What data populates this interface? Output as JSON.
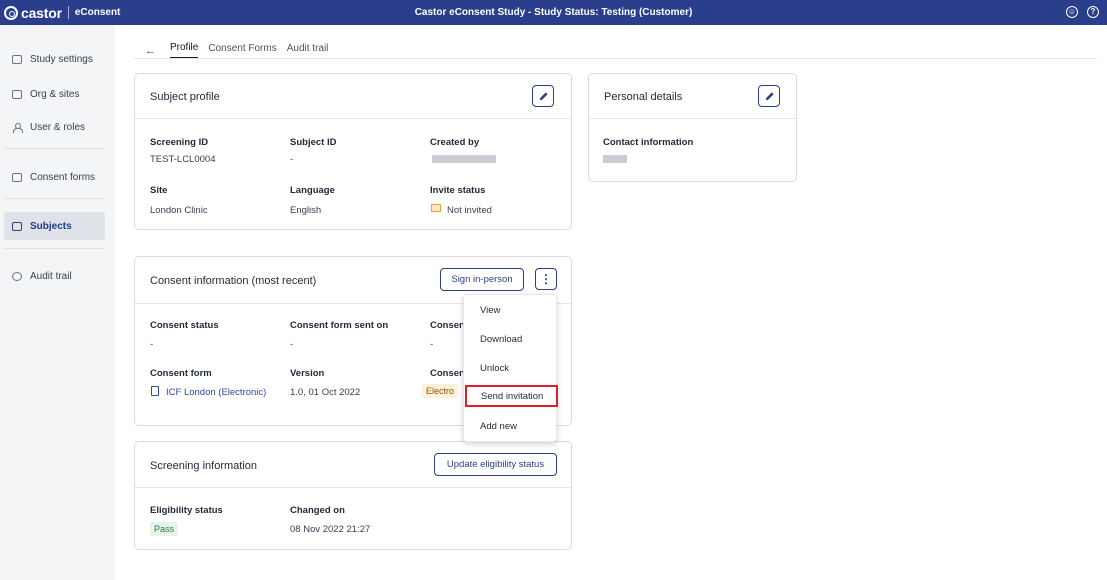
{
  "topbar": {
    "brand": "castor",
    "product": "eConsent",
    "study_title": "Castor eConsent Study  - Study Status: Testing (Customer)"
  },
  "sidebar": {
    "items": [
      {
        "label": "Study settings",
        "icon": "folder-icon"
      },
      {
        "label": "Org & sites",
        "icon": "building-icon"
      },
      {
        "label": "User & roles",
        "icon": "users-icon"
      },
      {
        "label": "Consent forms",
        "icon": "document-icon"
      },
      {
        "label": "Subjects",
        "icon": "subjects-icon",
        "active": true
      },
      {
        "label": "Audit trail",
        "icon": "history-icon"
      }
    ]
  },
  "tabs": [
    "Profile",
    "Consent Forms",
    "Audit trail"
  ],
  "subject_profile": {
    "title": "Subject profile",
    "fields": [
      {
        "label": "Screening ID",
        "value": "TEST-LCL0004"
      },
      {
        "label": "Subject ID",
        "value": "-"
      },
      {
        "label": "Created by",
        "value": ""
      },
      {
        "label": "Site",
        "value": "London Clinic"
      },
      {
        "label": "Language",
        "value": "English"
      },
      {
        "label": "Invite status",
        "value": "Not invited"
      }
    ]
  },
  "personal_details": {
    "title": "Personal details",
    "contact_label": "Contact information"
  },
  "consent_info": {
    "title": "Consent information (most recent)",
    "sign_button": "Sign in-person",
    "kebab": "⋮",
    "fields": [
      {
        "label": "Consent status",
        "value": "-"
      },
      {
        "label": "Consent form sent on",
        "value": "-"
      },
      {
        "label": "Consent",
        "value": "-"
      },
      {
        "label": "Consent form",
        "value": "ICF London (Electronic)"
      },
      {
        "label": "Version",
        "value": "1.0, 01 Oct 2022"
      },
      {
        "label": "Consent",
        "value": "Electro"
      }
    ]
  },
  "menu": {
    "items": [
      "View",
      "Download",
      "Unlock",
      "Send invitation",
      "Add new"
    ]
  },
  "screening": {
    "title": "Screening information",
    "update_button": "Update eligibility status",
    "fields": [
      {
        "label": "Eligibility status",
        "value": "Pass"
      },
      {
        "label": "Changed on",
        "value": "08 Nov 2022 21:27"
      }
    ]
  },
  "colors": {
    "topbar": "#2b3e8c",
    "accent": "#2b3e8c",
    "highlight": "#e11d2a",
    "pass_bg": "#e6f4ea"
  }
}
